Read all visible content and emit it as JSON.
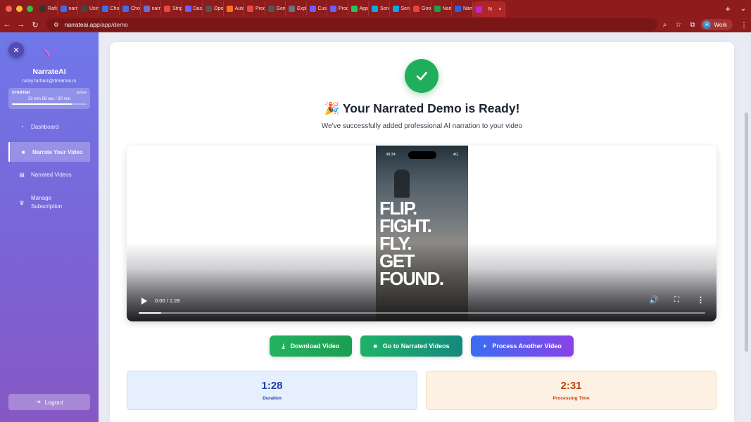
{
  "browser": {
    "tabs": [
      {
        "label": "Rafay",
        "color": "#333333"
      },
      {
        "label": "narrat",
        "color": "#3b6ee8"
      },
      {
        "label": "Using",
        "color": "#444444"
      },
      {
        "label": "Choo",
        "color": "#3b6ee8"
      },
      {
        "label": "Choo",
        "color": "#3b6ee8"
      },
      {
        "label": "narra",
        "color": "#6b6fcf"
      },
      {
        "label": "Stripe",
        "color": "#ef4444"
      },
      {
        "label": "Dash",
        "color": "#6d5dfc"
      },
      {
        "label": "Open",
        "color": "#555555"
      },
      {
        "label": "Auto",
        "color": "#f97316"
      },
      {
        "label": "Produ",
        "color": "#ef4444"
      },
      {
        "label": "Gem",
        "color": "#555555"
      },
      {
        "label": "Explo",
        "color": "#6b7280"
      },
      {
        "label": "Custo",
        "color": "#6d5dfc"
      },
      {
        "label": "Produ",
        "color": "#6d5dfc"
      },
      {
        "label": "Apps",
        "color": "#22c55e"
      },
      {
        "label": "Send",
        "color": "#0ea5e9"
      },
      {
        "label": "Send",
        "color": "#0ea5e9"
      },
      {
        "label": "Goog",
        "color": "#ea4335"
      },
      {
        "label": "Narra",
        "color": "#16a34a"
      },
      {
        "label": "Narra",
        "color": "#2563eb"
      }
    ],
    "active_tab": {
      "label": "N",
      "close": "×"
    },
    "new_tab": "+",
    "url_domain": "narrateai.app",
    "url_path": "/app/demo",
    "profile_initial": "R",
    "profile_label": "Work"
  },
  "sidebar": {
    "brand": "NarrateAI",
    "email": "rafay.farhan@dreamai.io",
    "plan": {
      "name": "STARTER",
      "status": "active",
      "usage": "23 min 58 sec / 30 min",
      "used_fraction": 0.8
    },
    "items": [
      {
        "label": "Dashboard",
        "icon": "dashboard-icon"
      },
      {
        "label": "Narrate Your Video",
        "icon": "video-camera-icon"
      },
      {
        "label": "Narrated Videos",
        "icon": "film-icon"
      },
      {
        "label": "Manage Subscription",
        "icon": "crown-icon"
      }
    ],
    "active_item": "Narrate Your Video",
    "logout": "Logout"
  },
  "main": {
    "title": "🎉 Your Narrated Demo is Ready!",
    "subtitle": "We've successfully added professional AI narration to your video",
    "video": {
      "phone_time": "08:34",
      "phone_signal": "4G",
      "poster_text": "FLIP.\nFIGHT.\nFLY.\nGET\nFOUND.",
      "time": "0:00 / 1:28",
      "progress_fraction": 0.04
    },
    "buttons": {
      "download": "Download Video",
      "go_narrated": "Go to Narrated Videos",
      "process_another": "Process Another Video"
    },
    "stats": {
      "duration_value": "1:28",
      "duration_label": "Duration",
      "processing_value": "2:31",
      "processing_label": "Processing Time"
    }
  },
  "colors": {
    "success_green": "#1fae5b",
    "duration_blue": "#1e3fa8",
    "processing_orange": "#c2410c",
    "browser_red": "#8e1c1c"
  }
}
